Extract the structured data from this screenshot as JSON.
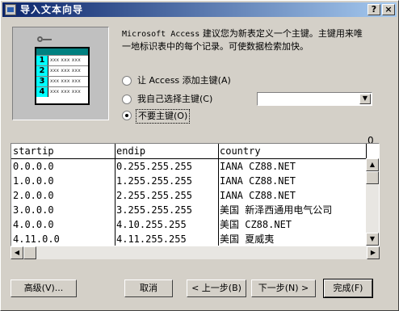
{
  "window": {
    "title": "导入文本向导",
    "help_label": "?",
    "close_label": "×"
  },
  "illustration": {
    "rows": [
      "1",
      "2",
      "3",
      "4"
    ],
    "cell_text": "xxx xxx xxx"
  },
  "description": {
    "line1_prefix": "Microsoft Access",
    "line1_rest": " 建议您为新表定义一个主键。主键用来唯",
    "line2": "一地标识表中的每个记录。可使数据检索加快。"
  },
  "options": [
    {
      "label": "让 Access 添加主键(A)",
      "checked": false
    },
    {
      "label": "我自己选择主键(C)",
      "checked": false
    },
    {
      "label": "不要主键(O)",
      "checked": true
    }
  ],
  "key_combo": {
    "value": ""
  },
  "column_index": "0",
  "preview": {
    "headers": [
      "startip",
      "endip",
      "country"
    ],
    "rows": [
      [
        "0.0.0.0",
        "0.255.255.255",
        "IANA  CZ88.NET"
      ],
      [
        "1.0.0.0",
        "1.255.255.255",
        "IANA  CZ88.NET"
      ],
      [
        "2.0.0.0",
        "2.255.255.255",
        "IANA  CZ88.NET"
      ],
      [
        "3.0.0.0",
        "3.255.255.255",
        "美国  新泽西通用电气公司"
      ],
      [
        "4.0.0.0",
        "4.10.255.255",
        "美国  CZ88.NET"
      ],
      [
        "4.11.0.0",
        "4.11.255.255",
        "美国  夏威夷"
      ]
    ]
  },
  "buttons": {
    "advanced": "高级(V)...",
    "cancel": "取消",
    "back": "< 上一步(B)",
    "next": "下一步(N) >",
    "finish": "完成(F)"
  },
  "icons": {
    "scroll_up": "▲",
    "scroll_down": "▼",
    "scroll_left": "◀",
    "scroll_right": "▶",
    "combo_arrow": "▼"
  }
}
